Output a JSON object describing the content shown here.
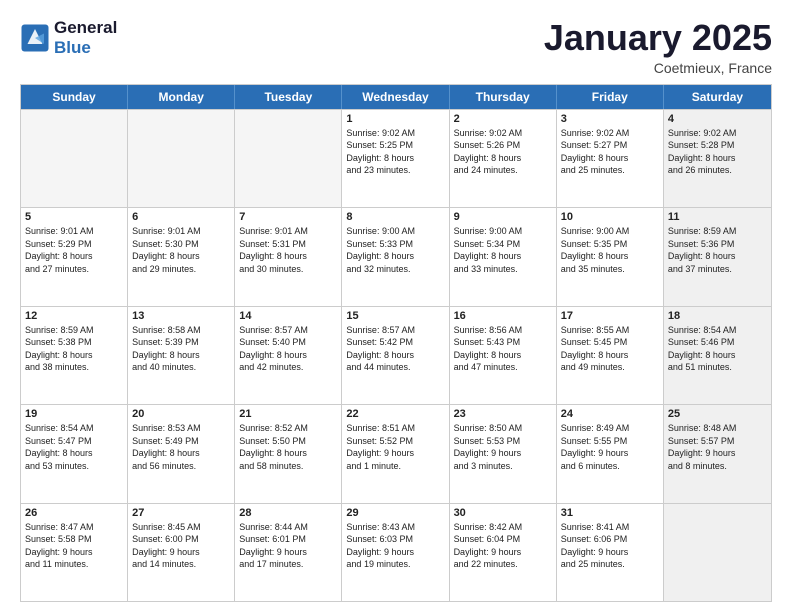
{
  "header": {
    "logo_line1": "General",
    "logo_line2": "Blue",
    "month_title": "January 2025",
    "location": "Coetmieux, France"
  },
  "weekdays": [
    "Sunday",
    "Monday",
    "Tuesday",
    "Wednesday",
    "Thursday",
    "Friday",
    "Saturday"
  ],
  "rows": [
    [
      {
        "day": "",
        "text": "",
        "empty": true
      },
      {
        "day": "",
        "text": "",
        "empty": true
      },
      {
        "day": "",
        "text": "",
        "empty": true
      },
      {
        "day": "1",
        "text": "Sunrise: 9:02 AM\nSunset: 5:25 PM\nDaylight: 8 hours\nand 23 minutes."
      },
      {
        "day": "2",
        "text": "Sunrise: 9:02 AM\nSunset: 5:26 PM\nDaylight: 8 hours\nand 24 minutes."
      },
      {
        "day": "3",
        "text": "Sunrise: 9:02 AM\nSunset: 5:27 PM\nDaylight: 8 hours\nand 25 minutes."
      },
      {
        "day": "4",
        "text": "Sunrise: 9:02 AM\nSunset: 5:28 PM\nDaylight: 8 hours\nand 26 minutes.",
        "shaded": true
      }
    ],
    [
      {
        "day": "5",
        "text": "Sunrise: 9:01 AM\nSunset: 5:29 PM\nDaylight: 8 hours\nand 27 minutes."
      },
      {
        "day": "6",
        "text": "Sunrise: 9:01 AM\nSunset: 5:30 PM\nDaylight: 8 hours\nand 29 minutes."
      },
      {
        "day": "7",
        "text": "Sunrise: 9:01 AM\nSunset: 5:31 PM\nDaylight: 8 hours\nand 30 minutes."
      },
      {
        "day": "8",
        "text": "Sunrise: 9:00 AM\nSunset: 5:33 PM\nDaylight: 8 hours\nand 32 minutes."
      },
      {
        "day": "9",
        "text": "Sunrise: 9:00 AM\nSunset: 5:34 PM\nDaylight: 8 hours\nand 33 minutes."
      },
      {
        "day": "10",
        "text": "Sunrise: 9:00 AM\nSunset: 5:35 PM\nDaylight: 8 hours\nand 35 minutes."
      },
      {
        "day": "11",
        "text": "Sunrise: 8:59 AM\nSunset: 5:36 PM\nDaylight: 8 hours\nand 37 minutes.",
        "shaded": true
      }
    ],
    [
      {
        "day": "12",
        "text": "Sunrise: 8:59 AM\nSunset: 5:38 PM\nDaylight: 8 hours\nand 38 minutes."
      },
      {
        "day": "13",
        "text": "Sunrise: 8:58 AM\nSunset: 5:39 PM\nDaylight: 8 hours\nand 40 minutes."
      },
      {
        "day": "14",
        "text": "Sunrise: 8:57 AM\nSunset: 5:40 PM\nDaylight: 8 hours\nand 42 minutes."
      },
      {
        "day": "15",
        "text": "Sunrise: 8:57 AM\nSunset: 5:42 PM\nDaylight: 8 hours\nand 44 minutes."
      },
      {
        "day": "16",
        "text": "Sunrise: 8:56 AM\nSunset: 5:43 PM\nDaylight: 8 hours\nand 47 minutes."
      },
      {
        "day": "17",
        "text": "Sunrise: 8:55 AM\nSunset: 5:45 PM\nDaylight: 8 hours\nand 49 minutes."
      },
      {
        "day": "18",
        "text": "Sunrise: 8:54 AM\nSunset: 5:46 PM\nDaylight: 8 hours\nand 51 minutes.",
        "shaded": true
      }
    ],
    [
      {
        "day": "19",
        "text": "Sunrise: 8:54 AM\nSunset: 5:47 PM\nDaylight: 8 hours\nand 53 minutes."
      },
      {
        "day": "20",
        "text": "Sunrise: 8:53 AM\nSunset: 5:49 PM\nDaylight: 8 hours\nand 56 minutes."
      },
      {
        "day": "21",
        "text": "Sunrise: 8:52 AM\nSunset: 5:50 PM\nDaylight: 8 hours\nand 58 minutes."
      },
      {
        "day": "22",
        "text": "Sunrise: 8:51 AM\nSunset: 5:52 PM\nDaylight: 9 hours\nand 1 minute."
      },
      {
        "day": "23",
        "text": "Sunrise: 8:50 AM\nSunset: 5:53 PM\nDaylight: 9 hours\nand 3 minutes."
      },
      {
        "day": "24",
        "text": "Sunrise: 8:49 AM\nSunset: 5:55 PM\nDaylight: 9 hours\nand 6 minutes."
      },
      {
        "day": "25",
        "text": "Sunrise: 8:48 AM\nSunset: 5:57 PM\nDaylight: 9 hours\nand 8 minutes.",
        "shaded": true
      }
    ],
    [
      {
        "day": "26",
        "text": "Sunrise: 8:47 AM\nSunset: 5:58 PM\nDaylight: 9 hours\nand 11 minutes."
      },
      {
        "day": "27",
        "text": "Sunrise: 8:45 AM\nSunset: 6:00 PM\nDaylight: 9 hours\nand 14 minutes."
      },
      {
        "day": "28",
        "text": "Sunrise: 8:44 AM\nSunset: 6:01 PM\nDaylight: 9 hours\nand 17 minutes."
      },
      {
        "day": "29",
        "text": "Sunrise: 8:43 AM\nSunset: 6:03 PM\nDaylight: 9 hours\nand 19 minutes."
      },
      {
        "day": "30",
        "text": "Sunrise: 8:42 AM\nSunset: 6:04 PM\nDaylight: 9 hours\nand 22 minutes."
      },
      {
        "day": "31",
        "text": "Sunrise: 8:41 AM\nSunset: 6:06 PM\nDaylight: 9 hours\nand 25 minutes."
      },
      {
        "day": "",
        "text": "",
        "empty": true,
        "shaded": true
      }
    ]
  ]
}
